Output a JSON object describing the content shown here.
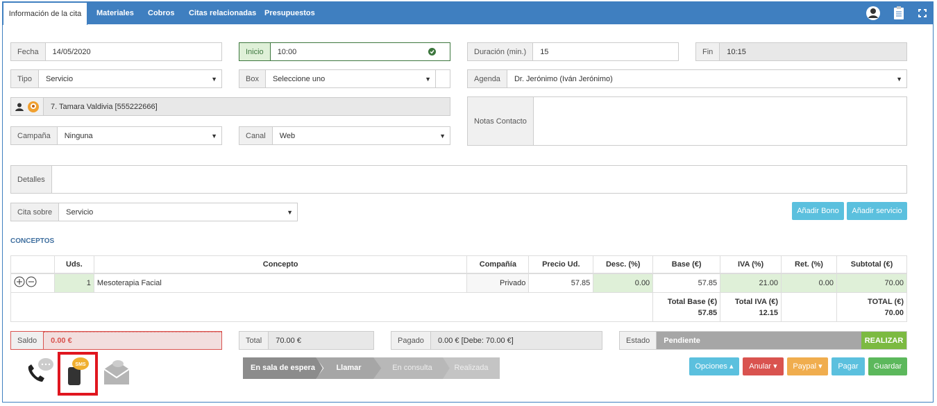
{
  "tabs": [
    {
      "label": "Información de la cita"
    },
    {
      "label": "Materiales"
    },
    {
      "label": "Cobros"
    },
    {
      "label": "Citas relacionadas"
    },
    {
      "label": "Presupuestos"
    }
  ],
  "form": {
    "fecha": {
      "label": "Fecha",
      "value": "14/05/2020"
    },
    "inicio": {
      "label": "Inicio",
      "value": "10:00"
    },
    "duracion": {
      "label": "Duración (min.)",
      "value": "15"
    },
    "fin": {
      "label": "Fin",
      "value": "10:15"
    },
    "tipo": {
      "label": "Tipo",
      "value": "Servicio"
    },
    "box": {
      "label": "Box",
      "value": "Seleccione uno"
    },
    "agenda": {
      "label": "Agenda",
      "value": "Dr. Jerónimo (Iván Jerónimo)"
    },
    "contacto": {
      "value": "7. Tamara Valdivia [555222666]"
    },
    "notas": {
      "label": "Notas Contacto",
      "value": ""
    },
    "campana": {
      "label": "Campaña",
      "value": "Ninguna"
    },
    "canal": {
      "label": "Canal",
      "value": "Web"
    },
    "detalles": {
      "label": "Detalles",
      "value": ""
    },
    "cita_sobre": {
      "label": "Cita sobre",
      "value": "Servicio"
    }
  },
  "buttons": {
    "anadir_bono": "Añadir Bono",
    "anadir_servicio": "Añadir servicio",
    "realizar": "REALIZAR",
    "opciones": "Opciones",
    "anular": "Anular",
    "paypal": "Paypal",
    "pagar": "Pagar",
    "guardar": "Guardar"
  },
  "conceptos_title": "CONCEPTOS",
  "table": {
    "headers": [
      "",
      "Uds.",
      "Concepto",
      "Compañía",
      "Precio Ud.",
      "Desc. (%)",
      "Base (€)",
      "IVA (%)",
      "Ret. (%)",
      "Subtotal (€)"
    ],
    "row": {
      "uds": "1",
      "concepto": "Mesoterapia Facial",
      "compania": "Privado",
      "precio": "57.85",
      "desc": "0.00",
      "base": "57.85",
      "iva": "21.00",
      "ret": "0.00",
      "subtotal": "70.00"
    },
    "totals": {
      "base_label": "Total Base (€)",
      "base": "57.85",
      "iva_label": "Total IVA (€)",
      "iva": "12.15",
      "total_label": "TOTAL (€)",
      "total": "70.00"
    }
  },
  "footer": {
    "saldo": {
      "label": "Saldo",
      "value": "0.00 €"
    },
    "total": {
      "label": "Total",
      "value": "70.00 €"
    },
    "pagado": {
      "label": "Pagado",
      "value": "0.00 € [Debe: 70.00 €]"
    },
    "estado": {
      "label": "Estado",
      "value": "Pendiente"
    }
  },
  "steps": [
    "En sala de espera",
    "Llamar",
    "En consulta",
    "Realizada"
  ],
  "sms_badge": "SMS"
}
